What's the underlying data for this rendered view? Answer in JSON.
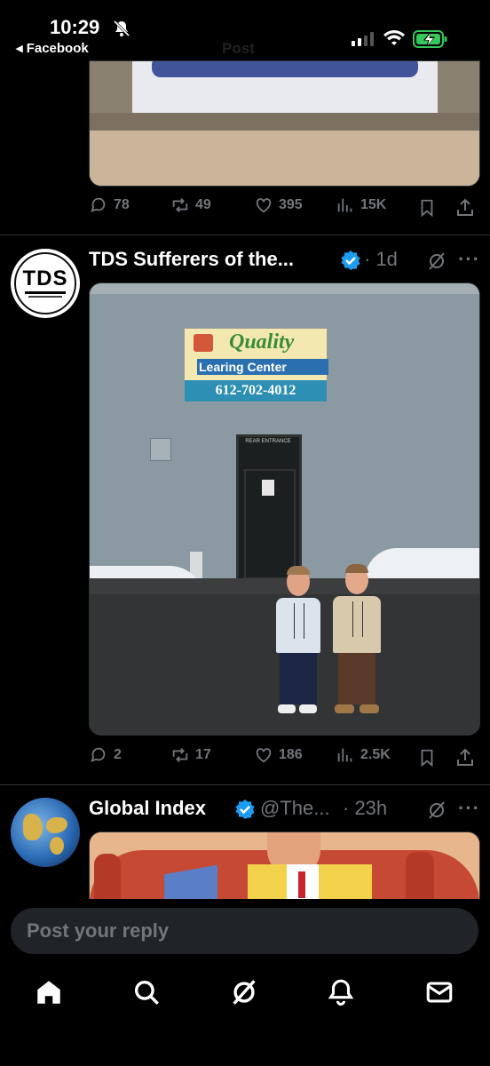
{
  "status_bar": {
    "time": "10:29",
    "back_label": "◂ Facebook",
    "faded_title": "Post"
  },
  "post1": {
    "stats": {
      "replies": "78",
      "reposts": "49",
      "likes": "395",
      "views": "15K"
    }
  },
  "post2": {
    "author": "TDS Sufferers of the...",
    "dot_time": "· 1d",
    "avatar_text": "TDS",
    "image": {
      "sign_title": "Quality",
      "sign_sub": "Learing Center",
      "sign_phone": "612-702-4012",
      "door_sign": "REAR ENTRANCE"
    },
    "stats": {
      "replies": "2",
      "reposts": "17",
      "likes": "186",
      "views": "2.5K"
    }
  },
  "post3": {
    "author": "Global Index",
    "handle": "@The...",
    "dot_time": "· 23h"
  },
  "reply": {
    "placeholder": "Post your reply"
  },
  "colors": {
    "background": "#000000",
    "muted": "#71767b",
    "verified": "#1d9bf0",
    "divider": "#2f3336"
  }
}
